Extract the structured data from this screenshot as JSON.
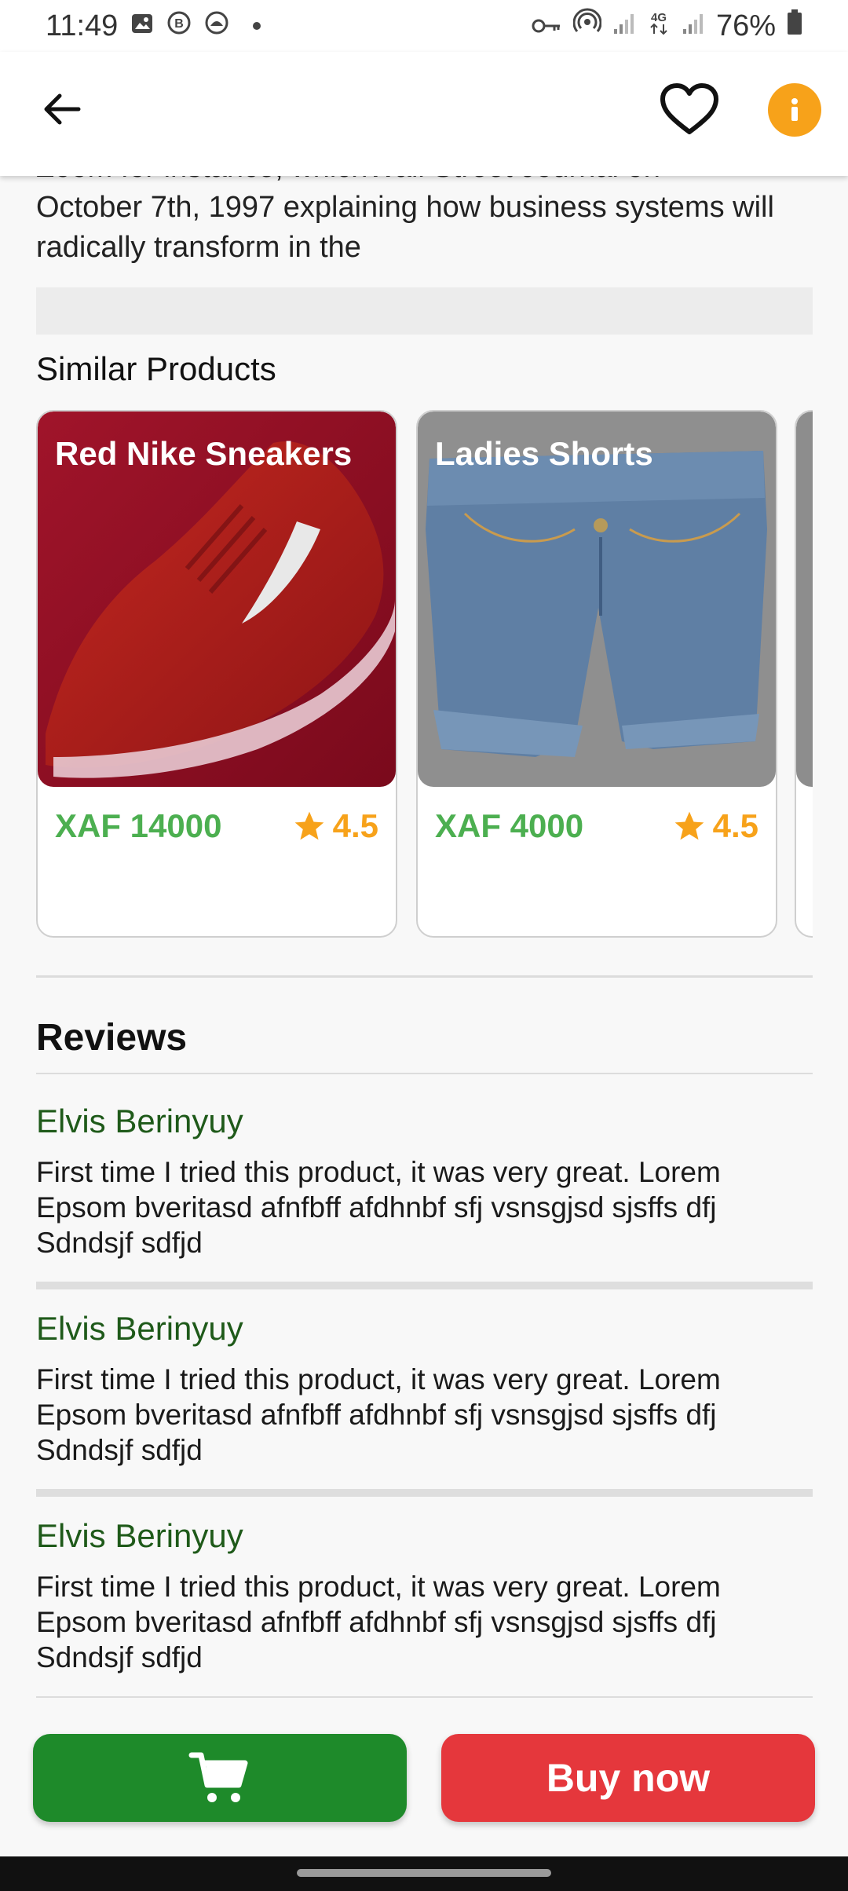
{
  "status_bar": {
    "time": "11:49",
    "battery": "76%",
    "icons": [
      "image-icon",
      "b-icon",
      "circle-icon",
      "key-icon",
      "hotspot-icon",
      "signal-icon",
      "4g-icon",
      "signal-icon",
      "battery-icon"
    ]
  },
  "app_bar": {
    "back_icon": "arrow-left-icon",
    "favorite_icon": "heart-outline-icon",
    "info_icon": "info-icon",
    "info_color": "#f7a21a"
  },
  "description": {
    "text_partial_top": "Zoom for instance, whichWall Street Journal on",
    "text": "October 7th, 1997 explaining how business systems will radically transform in the"
  },
  "similar_products": {
    "title": "Similar Products",
    "items": [
      {
        "name": "Red Nike Sneakers",
        "price": "XAF 14000",
        "rating": "4.5",
        "image": "red-sneaker-image"
      },
      {
        "name": "Ladies Shorts",
        "price": "XAF 4000",
        "rating": "4.5",
        "image": "denim-shorts-image"
      }
    ]
  },
  "reviews": {
    "title": "Reviews",
    "items": [
      {
        "name": "Elvis Berinyuy",
        "text": "First time I tried this product, it was very great. Lorem Epsom bveritasd afnfbff afdhnbf sfj vsnsgjsd sjsffs dfj Sdndsjf sdfjd"
      },
      {
        "name": "Elvis Berinyuy",
        "text": "First time I tried this product, it was very great. Lorem Epsom bveritasd afnfbff afdhnbf sfj vsnsgjsd sjsffs dfj Sdndsjf sdfjd"
      },
      {
        "name": "Elvis Berinyuy",
        "text": "First time I tried this product, it was very great. Lorem Epsom bveritasd afnfbff afdhnbf sfj vsnsgjsd sjsffs dfj Sdndsjf sdfjd"
      }
    ]
  },
  "actions": {
    "cart_icon": "cart-icon",
    "cart_color": "#1e8a2a",
    "buy_label": "Buy now",
    "buy_color": "#e5373c"
  },
  "colors": {
    "price": "#4caf50",
    "rating": "#f7a21a",
    "reviewer": "#1f5a1a"
  }
}
